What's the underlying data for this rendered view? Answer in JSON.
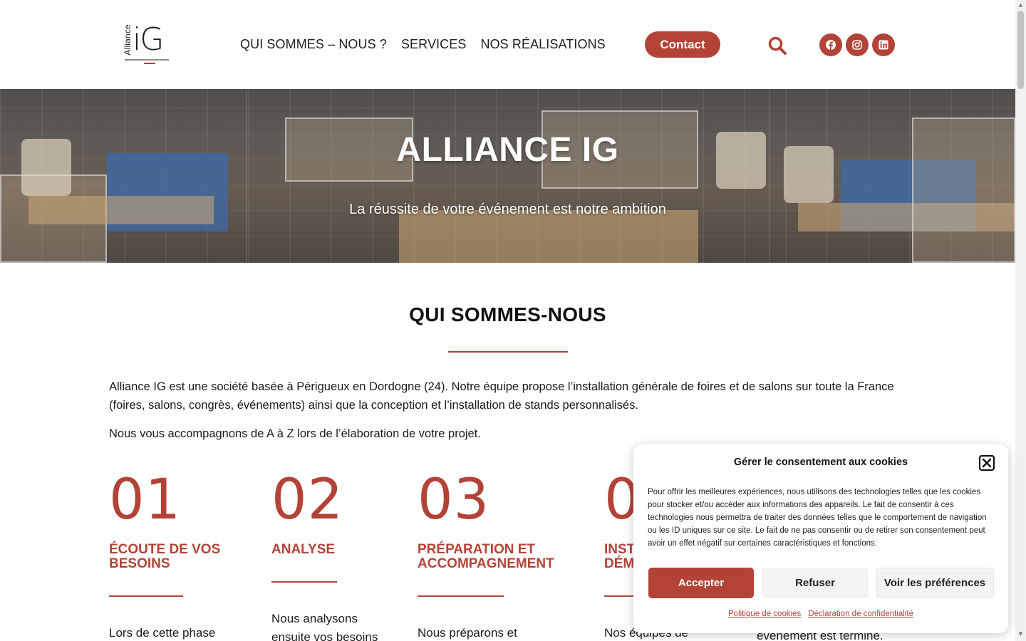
{
  "colors": {
    "accent": "#b34337",
    "text": "#1a1a1a",
    "background": "#ffffff"
  },
  "header": {
    "logo": {
      "word": "Alliance",
      "letters": "iG"
    },
    "nav": [
      {
        "label": "QUI SOMMES – NOUS ?"
      },
      {
        "label": "SERVICES"
      },
      {
        "label": "NOS RÉALISATIONS"
      }
    ],
    "contact_label": "Contact",
    "icons": {
      "search": "search-icon",
      "facebook": "facebook-icon",
      "instagram": "instagram-icon",
      "linkedin": "linkedin-icon"
    }
  },
  "hero": {
    "title": "ALLIANCE IG",
    "subtitle": "La réussite de votre événement est notre ambition"
  },
  "about": {
    "title": "QUI SOMMES-NOUS",
    "paragraph1": "Alliance IG est une société basée à Périgueux en Dordogne (24). Notre équipe propose l’installation générale de foires et de salons sur toute la France (foires, salons, congrès, événements) ainsi que la conception et l’installation de stands personnalisés.",
    "paragraph2": "Nous vous accompagnons de A à Z lors de l’élaboration de votre projet.",
    "steps": [
      {
        "number": "01",
        "title": "ÉCOUTE DE VOS BESOINS",
        "text": "Lors de cette phase"
      },
      {
        "number": "02",
        "title": "ANALYSE",
        "text": "Nous analysons ensuite vos besoins"
      },
      {
        "number": "03",
        "title": "PRÉPARATION ET ACCOMPAGNEMENT",
        "text": "Nous préparons et"
      },
      {
        "number": "0",
        "title": "INST DÉM",
        "text": "Nos équipes de"
      }
    ],
    "step5_text": "événement est terminé."
  },
  "cookie": {
    "title": "Gérer le consentement aux cookies",
    "body": "Pour offrir les meilleures expériences, nous utilisons des technologies telles que les cookies pour stocker et/ou accéder aux informations des appareils. Le fait de consentir à ces technologies nous permettra de traiter des données telles que le comportement de navigation ou les ID uniques sur ce site. Le fait de ne pas consentir ou de retirer son consentement peut avoir un effet négatif sur certaines caractéristiques et fonctions.",
    "accept_label": "Accepter",
    "refuse_label": "Refuser",
    "prefs_label": "Voir les préférences",
    "policy_link": "Politique de cookies",
    "privacy_link": "Déclaration de confidentialité"
  }
}
